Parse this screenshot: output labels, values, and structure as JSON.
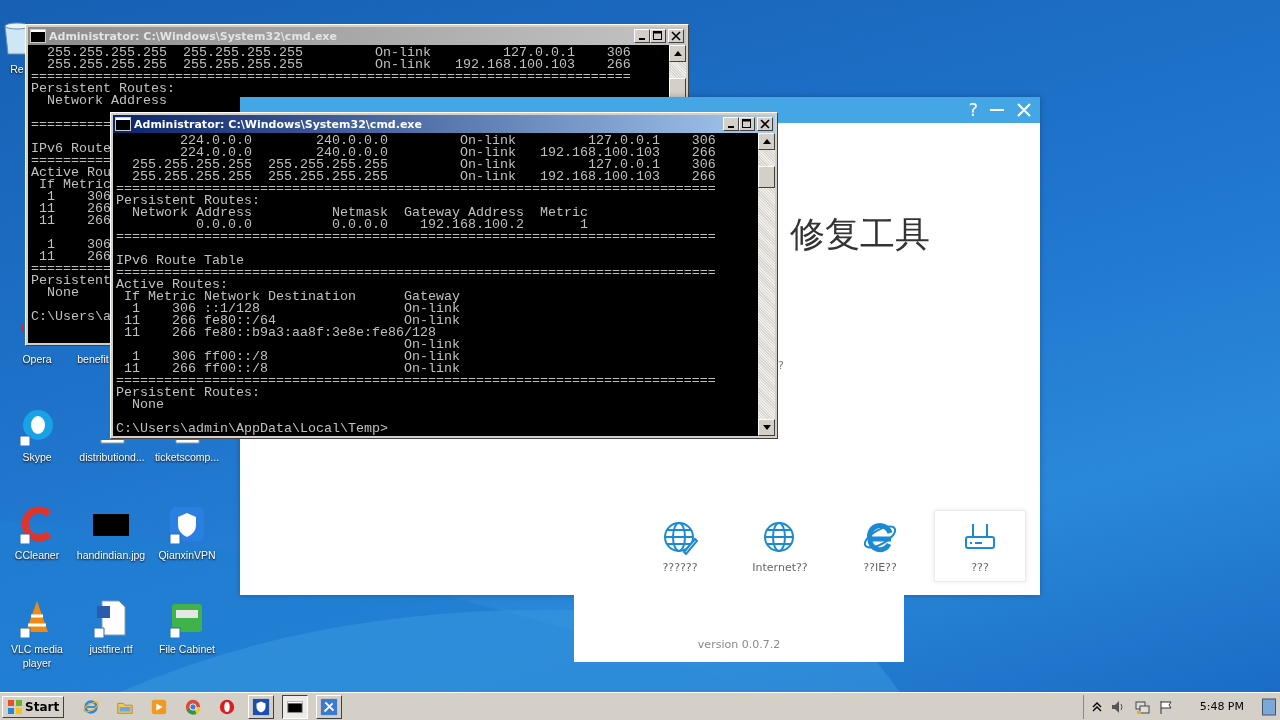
{
  "desktop_icons": [
    {
      "label": "Re",
      "kind": "bin"
    },
    {
      "label": "Opera",
      "kind": "opera"
    },
    {
      "label": "benefit"
    },
    {
      "label": "Skype",
      "kind": "skype"
    },
    {
      "label": "distributiond...",
      "kind": "doc"
    },
    {
      "label": "ticketscomp...",
      "kind": "doc"
    },
    {
      "label": "CCleaner",
      "kind": "ccleaner"
    },
    {
      "label": "handindian.jpg",
      "kind": "image"
    },
    {
      "label": "QianxinVPN",
      "kind": "vpn"
    },
    {
      "label": "VLC media player",
      "kind": "vlc"
    },
    {
      "label": "justfire.rtf",
      "kind": "word"
    },
    {
      "label": "File Cabinet",
      "kind": "cabinet"
    }
  ],
  "consoles": [
    {
      "title": "Administrator: C:\\Windows\\System32\\cmd.exe",
      "active": false,
      "blocks": [
        [
          "  255.255.255.255  255.255.255.255         On-link         127.0.0.1    306",
          "  255.255.255.255  255.255.255.255         On-link   192.168.100.103    266",
          "===========================================================================",
          "Persistent Routes:",
          "  Network Address"
        ],
        [
          "=========="
        ],
        [
          "IPv6 Route",
          "==========",
          "Active Rou",
          " If Metric",
          "  1    306",
          " 11    266",
          " 11    266"
        ],
        [
          "  1    306",
          " 11    266",
          "==========",
          "Persistent",
          "  None"
        ],
        [
          "C:\\Users\\a"
        ]
      ]
    },
    {
      "title": "Administrator: C:\\Windows\\System32\\cmd.exe",
      "active": true,
      "blocks": [
        [
          "        224.0.0.0        240.0.0.0         On-link         127.0.0.1    306",
          "        224.0.0.0        240.0.0.0         On-link   192.168.100.103    266",
          "  255.255.255.255  255.255.255.255         On-link         127.0.0.1    306",
          "  255.255.255.255  255.255.255.255         On-link   192.168.100.103    266",
          "===========================================================================",
          "Persistent Routes:",
          "  Network Address          Netmask  Gateway Address  Metric",
          "          0.0.0.0          0.0.0.0    192.168.100.2       1",
          "==========================================================================="
        ],
        [
          "IPv6 Route Table",
          "===========================================================================",
          "Active Routes:",
          " If Metric Network Destination      Gateway",
          "  1    306 ::1/128                  On-link",
          " 11    266 fe80::/64                On-link",
          " 11    266 fe80::b9a3:aa8f:3e8e:fe86/128",
          "                                    On-link",
          "  1    306 ff00::/8                 On-link",
          " 11    266 ff00::/8                 On-link",
          "===========================================================================",
          "Persistent Routes:",
          "  None"
        ],
        [
          "C:\\Users\\admin\\AppData\\Local\\Temp>"
        ]
      ]
    }
  ],
  "app": {
    "help": "?",
    "heading": "修复工具",
    "note": "?",
    "tools": [
      {
        "label": "??????",
        "kind": "globe-pen",
        "selected": false
      },
      {
        "label": "Internet??",
        "kind": "globe",
        "selected": false
      },
      {
        "label": "??IE??",
        "kind": "ie",
        "selected": false
      },
      {
        "label": "???",
        "kind": "router",
        "selected": true
      }
    ]
  },
  "version_panel": {
    "text": "version 0.0.7.2"
  },
  "taskbar": {
    "start": "Start",
    "apps": [
      {
        "kind": "ie",
        "active": false,
        "open": false
      },
      {
        "kind": "folder",
        "active": false,
        "open": false
      },
      {
        "kind": "media",
        "active": false,
        "open": false
      },
      {
        "kind": "chrome",
        "active": false,
        "open": false
      },
      {
        "kind": "opera",
        "active": false,
        "open": false
      },
      {
        "kind": "vpn",
        "active": false,
        "open": true
      },
      {
        "kind": "cmd",
        "active": true,
        "open": true
      },
      {
        "kind": "tools",
        "active": false,
        "open": true
      }
    ],
    "clock": "5:48 PM"
  }
}
